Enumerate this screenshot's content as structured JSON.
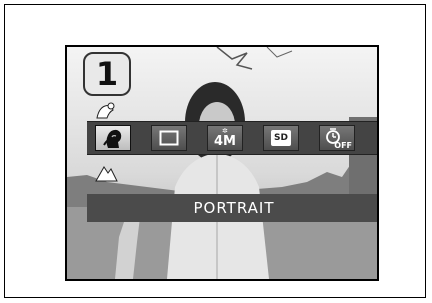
{
  "step_number": "1",
  "menu": {
    "items": [
      {
        "name": "portrait-mode",
        "icon": "portrait-icon",
        "text": "",
        "selected": true
      },
      {
        "name": "single-frame",
        "icon": "single-frame-icon",
        "text": "",
        "selected": false
      },
      {
        "name": "resolution",
        "icon": "resolution-4m-icon",
        "text": "4M",
        "selected": false
      },
      {
        "name": "storage-card",
        "icon": "sd-card-icon",
        "text": "SD",
        "selected": false
      },
      {
        "name": "self-timer",
        "icon": "self-timer-off-icon",
        "text": "OFF",
        "selected": false
      }
    ]
  },
  "side_icons": [
    "scenery-mode-icon",
    "landscape-mode-icon"
  ],
  "mode_label": "PORTRAIT"
}
